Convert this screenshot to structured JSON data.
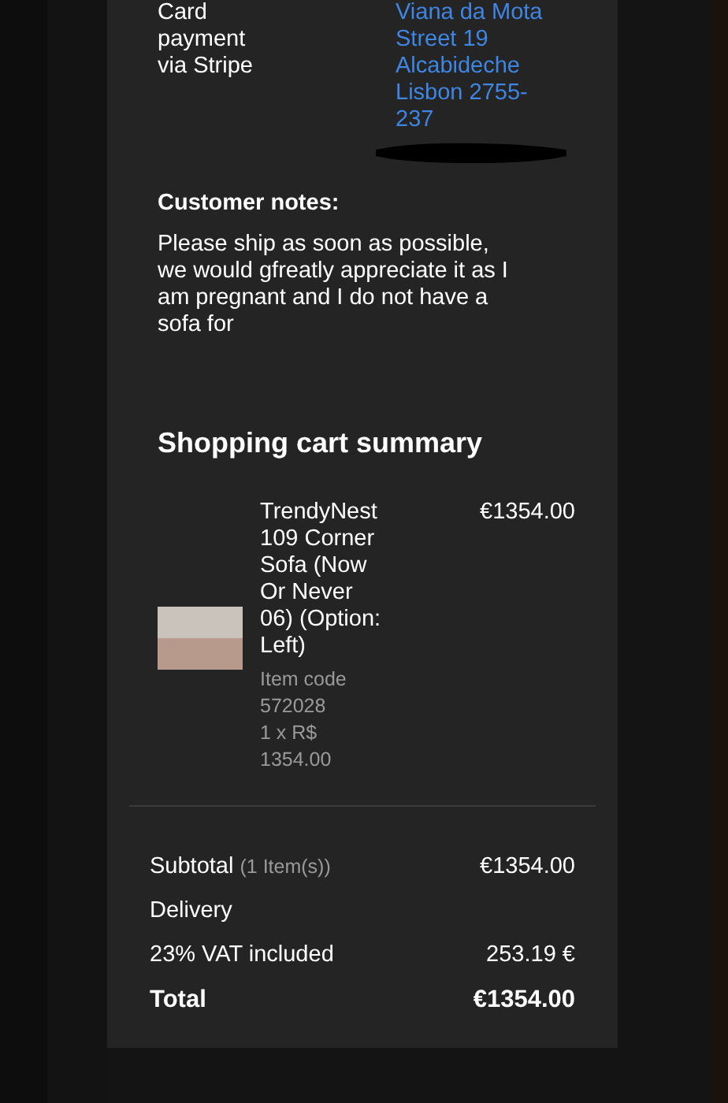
{
  "order_info": {
    "payment": "Card payment via Stripe",
    "address": "Viana da Mota Street 19 Alcabideche Lisbon 2755-237"
  },
  "customer_notes": {
    "heading": "Customer notes:",
    "text": "Please ship as soon as possible, we would gfreatly appreciate it as I am pregnant and I do not have a sofa for"
  },
  "cart": {
    "heading": "Shopping cart summary",
    "items": [
      {
        "name": "TrendyNest 109 Corner Sofa (Now Or Never 06) (Option: Left)",
        "item_code_label": "Item code",
        "item_code": "572028",
        "quantity_price": "1 x R$ 1354.00",
        "price": "€1354.00"
      }
    ]
  },
  "totals": [
    {
      "kind": "subtotal",
      "label": "Subtotal",
      "note": "(1 Item(s))",
      "value": "€1354.00"
    },
    {
      "kind": "plain",
      "label": "Delivery"
    },
    {
      "kind": "plain",
      "label": "23% VAT included",
      "value": "253.19 €"
    },
    {
      "kind": "total",
      "label": "Total",
      "value": "€1354.00"
    }
  ]
}
